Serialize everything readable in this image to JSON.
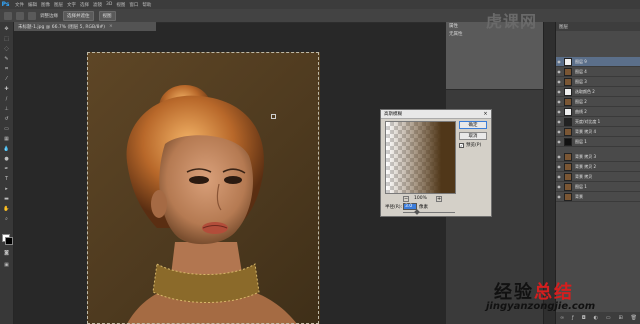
{
  "app": {
    "logo": "Ps"
  },
  "menu": [
    "文件",
    "编辑",
    "图像",
    "图层",
    "文字",
    "选择",
    "滤镜",
    "3D",
    "视图",
    "窗口",
    "帮助"
  ],
  "options_bar": {
    "label": "调整边缘",
    "btn1": "选择并遮住",
    "btn2": "视图"
  },
  "document_tab": {
    "title": "未标题-1.jpg @ 66.7% (图层 5, RGB/8#)",
    "close": "×"
  },
  "properties_panel": {
    "title": "属性",
    "subtitle": "无属性"
  },
  "watermark_top": "虎课网",
  "layers_panel": {
    "title": "图层",
    "layers": [
      {
        "name": "图层 9",
        "selected": true
      },
      {
        "name": "图层 4"
      },
      {
        "name": "图层 3"
      },
      {
        "name": "选取颜色 2"
      },
      {
        "name": "图层 2"
      },
      {
        "name": "曲线 2"
      },
      {
        "name": "亮度/对比度 1"
      },
      {
        "name": "背景 拷贝 4"
      },
      {
        "name": "图层 1"
      },
      {
        "name": "背景 拷贝 3"
      },
      {
        "name": "背景 拷贝 2"
      },
      {
        "name": "背景 拷贝"
      },
      {
        "name": "图层 1"
      },
      {
        "name": "背景"
      }
    ],
    "footer_icons": [
      "link-icon",
      "fx-icon",
      "mask-icon",
      "adjustment-icon",
      "folder-icon",
      "new-layer-icon",
      "trash-icon"
    ]
  },
  "dialog": {
    "title": "高斯模糊",
    "close": "×",
    "ok": "确定",
    "cancel": "取消",
    "preview_checked": true,
    "preview_label": "预览(P)",
    "zoom": "100%",
    "zoom_out": "−",
    "zoom_in": "+",
    "radius_label": "半径(R):",
    "radius_value": "3.0",
    "radius_unit": "像素"
  },
  "branding": {
    "name_black": "经验",
    "name_red": "总结",
    "url": "jingyanzongjie.com"
  }
}
